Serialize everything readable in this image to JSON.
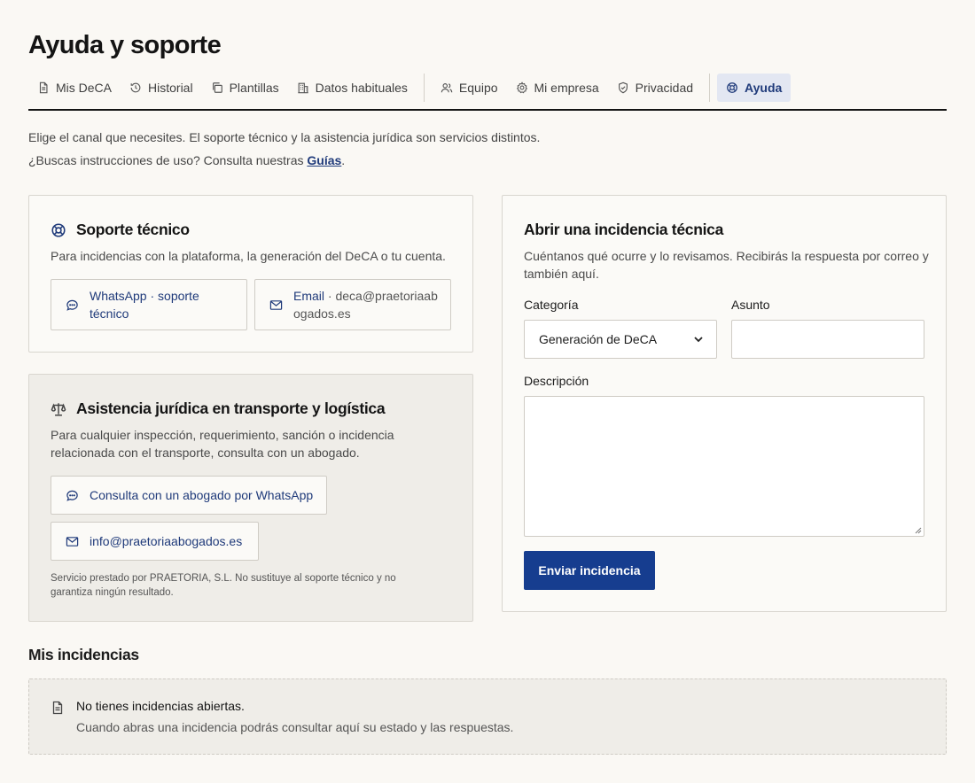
{
  "page": {
    "title": "Ayuda y soporte"
  },
  "tabs": [
    {
      "label": "Mis DeCA",
      "icon": "document-icon"
    },
    {
      "label": "Historial",
      "icon": "history-icon"
    },
    {
      "label": "Plantillas",
      "icon": "copy-icon"
    },
    {
      "label": "Datos habituales",
      "icon": "building-icon"
    },
    {
      "label": "Equipo",
      "icon": "users-icon"
    },
    {
      "label": "Mi empresa",
      "icon": "gear-icon"
    },
    {
      "label": "Privacidad",
      "icon": "shield-icon"
    },
    {
      "label": "Ayuda",
      "icon": "lifebuoy-icon",
      "active": true
    }
  ],
  "intro": {
    "line1": "Elige el canal que necesites. El soporte técnico y la asistencia jurídica son servicios distintos.",
    "line2_prefix": "¿Buscas instrucciones de uso? Consulta nuestras ",
    "line2_link": "Guías",
    "line2_suffix": "."
  },
  "support": {
    "title": "Soporte técnico",
    "subtitle": "Para incidencias con la plataforma, la generación del DeCA o tu cuenta.",
    "whatsapp_label": "WhatsApp · soporte técnico",
    "email_label": "Email",
    "email_sep": " · ",
    "email_value": "deca@praetoriaabogados.es"
  },
  "legal": {
    "title": "Asistencia jurídica en transporte y logística",
    "subtitle": "Para cualquier inspección, requerimiento, sanción o incidencia relacionada con el transporte, consulta con un abogado.",
    "whatsapp_label": "Consulta con un abogado por WhatsApp",
    "email_label": "info@praetoriaabogados.es",
    "disclaimer": "Servicio prestado por PRAETORIA, S.L. No sustituye al soporte técnico y no garantiza ningún resultado."
  },
  "ticket_form": {
    "title": "Abrir una incidencia técnica",
    "subtitle": "Cuéntanos qué ocurre y lo revisamos. Recibirás la respuesta por correo y también aquí.",
    "category_label": "Categoría",
    "category_value": "Generación de DeCA",
    "subject_label": "Asunto",
    "subject_value": "",
    "description_label": "Descripción",
    "description_value": "",
    "submit_label": "Enviar incidencia"
  },
  "my_tickets": {
    "title": "Mis incidencias",
    "empty_title": "No tienes incidencias abiertas.",
    "empty_text": "Cuando abras una incidencia podrás consultar aquí su estado y las respuestas."
  },
  "colors": {
    "accent": "#163d8f",
    "background": "#faf8f4",
    "active_tab_bg": "#e3e7f2"
  }
}
